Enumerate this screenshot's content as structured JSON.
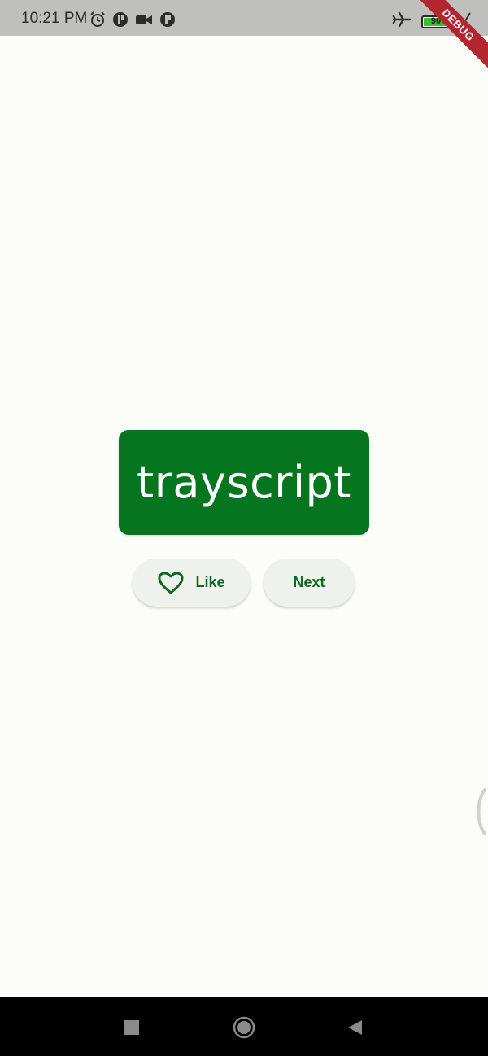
{
  "status_bar": {
    "time": "10:21 PM",
    "battery_level": 90,
    "battery_text": "90",
    "icons_left": [
      "alarm-icon",
      "app-notification-icon",
      "video-camera-icon",
      "app-notification-icon"
    ],
    "icons_right": [
      "airplane-mode-icon",
      "battery-icon",
      "battery-saver-icon"
    ]
  },
  "debug_banner": "DEBUG",
  "word_card": {
    "word": "trayscript"
  },
  "actions": {
    "like_label": "Like",
    "next_label": "Next"
  },
  "navigation": {
    "buttons": [
      "recents-square-icon",
      "home-circle-icon",
      "back-triangle-icon"
    ]
  },
  "colors": {
    "primary": "#05761f",
    "button_bg": "#eef1ec",
    "button_text": "#0b6a1e",
    "background": "#fcfcf8"
  }
}
